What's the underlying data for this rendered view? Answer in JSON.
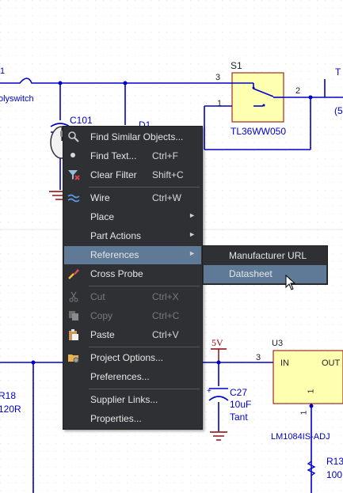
{
  "schematic": {
    "polyswitch": "olyswitch",
    "c101": "C101",
    "d1": "D1",
    "s1": "S1",
    "s1_part": "TL36WW050",
    "pin3_s1": "3",
    "pin1_s1": "1",
    "pin2_s1": "2",
    "pin1_left": "1",
    "t_label": "T",
    "five_paren": "(5",
    "five_v": "5V",
    "u3": "U3",
    "in": "IN",
    "out": "OUT",
    "pin3_u3": "3",
    "pin1_u3": "1",
    "pin1_below": "1",
    "c27": "C27",
    "c27_val": "10uF",
    "c27_type": "Tant",
    "r18": "R18",
    "r18_val": "120R",
    "u3_part": "LM1084IS-ADJ",
    "r13": "R13",
    "r13_val": "100"
  },
  "menu": {
    "items": [
      {
        "label": "Find Similar Objects...",
        "shortcut": "",
        "icon": "find-similar-icon"
      },
      {
        "label": "Find Text...",
        "shortcut": "Ctrl+F",
        "icon": "find-text-icon"
      },
      {
        "label": "Clear Filter",
        "shortcut": "Shift+C",
        "icon": "clear-filter-icon"
      },
      {
        "label": "Wire",
        "shortcut": "Ctrl+W",
        "icon": "wire-icon"
      },
      {
        "label": "Place",
        "shortcut": "",
        "icon": ""
      },
      {
        "label": "Part Actions",
        "shortcut": "",
        "icon": ""
      },
      {
        "label": "References",
        "shortcut": "",
        "icon": ""
      },
      {
        "label": "Cross Probe",
        "shortcut": "",
        "icon": "cross-probe-icon"
      },
      {
        "label": "Cut",
        "shortcut": "Ctrl+X",
        "icon": "scissors-icon"
      },
      {
        "label": "Copy",
        "shortcut": "Ctrl+C",
        "icon": "copy-icon"
      },
      {
        "label": "Paste",
        "shortcut": "Ctrl+V",
        "icon": "paste-icon"
      },
      {
        "label": "Project Options...",
        "shortcut": "",
        "icon": "project-options-icon"
      },
      {
        "label": "Preferences...",
        "shortcut": "",
        "icon": ""
      },
      {
        "label": "Supplier Links...",
        "shortcut": "",
        "icon": ""
      },
      {
        "label": "Properties...",
        "shortcut": "",
        "icon": ""
      }
    ],
    "submenu_arrow": "►"
  },
  "submenu": {
    "items": [
      {
        "label": "Manufacturer URL"
      },
      {
        "label": "Datasheet"
      }
    ]
  },
  "colors": {
    "wire": "#0000CC",
    "component_fill": "#FFFFB0",
    "component_border": "#8B0000",
    "menu_bg": "#2F3033",
    "menu_highlight": "#5E7A97",
    "ground_power": "#8B0000"
  }
}
